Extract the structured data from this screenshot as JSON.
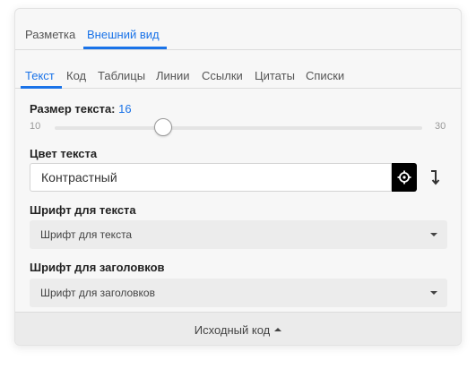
{
  "top_tabs": [
    {
      "label": "Разметка",
      "active": false
    },
    {
      "label": "Внешний вид",
      "active": true
    }
  ],
  "sub_tabs": [
    {
      "label": "Текст",
      "active": true
    },
    {
      "label": "Код",
      "active": false
    },
    {
      "label": "Таблицы",
      "active": false
    },
    {
      "label": "Линии",
      "active": false
    },
    {
      "label": "Ссылки",
      "active": false
    },
    {
      "label": "Цитаты",
      "active": false
    },
    {
      "label": "Списки",
      "active": false
    }
  ],
  "text_size": {
    "label": "Размер текста:",
    "value": "16",
    "min": "10",
    "max": "30"
  },
  "text_color": {
    "label": "Цвет текста",
    "value": "Контрастный",
    "picker_icon": "crosshair-icon",
    "reset_icon": "reset-arrow-icon"
  },
  "text_font": {
    "label": "Шрифт для текста",
    "selected": "Шрифт для текста"
  },
  "heading_font": {
    "label": "Шрифт для заголовков",
    "selected": "Шрифт для заголовков"
  },
  "footer": {
    "label": "Исходный код"
  },
  "colors": {
    "accent": "#1a73e8",
    "panel_bg": "#f7f7f7",
    "picker_bg": "#000000"
  }
}
